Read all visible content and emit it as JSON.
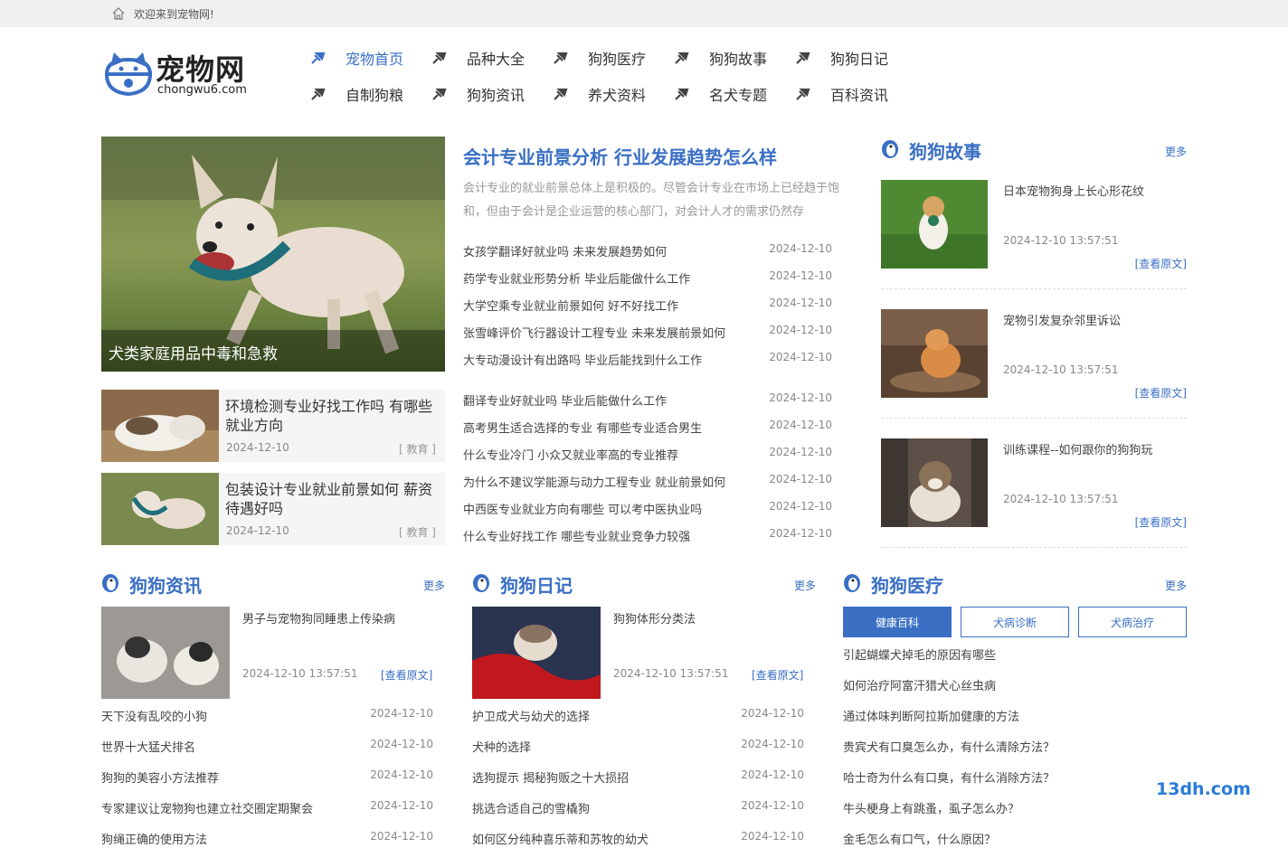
{
  "topbar": {
    "welcome": "欢迎来到宠物网!"
  },
  "logo": {
    "cn": "宠物网",
    "en": "chongwu6.com"
  },
  "nav": [
    {
      "label": "宠物首页",
      "active": true
    },
    {
      "label": "品种大全"
    },
    {
      "label": "狗狗医疗"
    },
    {
      "label": "狗狗故事"
    },
    {
      "label": "狗狗日记"
    },
    {
      "label": "自制狗粮"
    },
    {
      "label": "狗狗资讯"
    },
    {
      "label": "养犬资料"
    },
    {
      "label": "名犬专题"
    },
    {
      "label": "百科资讯"
    }
  ],
  "hero": {
    "caption": "犬类家庭用品中毒和急救"
  },
  "cards": [
    {
      "title": "环境检测专业好找工作吗 有哪些就业方向",
      "date": "2024-12-10",
      "tag": "[ 教育 ]"
    },
    {
      "title": "包装设计专业就业前景如何 薪资待遇好吗",
      "date": "2024-12-10",
      "tag": "[ 教育 ]"
    }
  ],
  "headline": {
    "title": "会计专业前景分析 行业发展趋势怎么样",
    "summary": "会计专业的就业前景总体上是积极的。尽管会计专业在市场上已经趋于饱和，但由于会计是企业运营的核心部门，对会计人才的需求仍然存"
  },
  "news_group1": [
    {
      "title": "女孩学翻译好就业吗 未来发展趋势如何",
      "date": "2024-12-10"
    },
    {
      "title": "药学专业就业形势分析 毕业后能做什么工作",
      "date": "2024-12-10"
    },
    {
      "title": "大学空乘专业就业前景如何 好不好找工作",
      "date": "2024-12-10"
    },
    {
      "title": "张雪峰评价飞行器设计工程专业 未来发展前景如何",
      "date": "2024-12-10"
    },
    {
      "title": "大专动漫设计有出路吗 毕业后能找到什么工作",
      "date": "2024-12-10"
    }
  ],
  "news_group2": [
    {
      "title": "翻译专业好就业吗 毕业后能做什么工作",
      "date": "2024-12-10"
    },
    {
      "title": "高考男生适合选择的专业 有哪些专业适合男生",
      "date": "2024-12-10"
    },
    {
      "title": "什么专业冷门 小众又就业率高的专业推荐",
      "date": "2024-12-10"
    },
    {
      "title": "为什么不建议学能源与动力工程专业 就业前景如何",
      "date": "2024-12-10"
    },
    {
      "title": "中西医专业就业方向有哪些 可以考中医执业吗",
      "date": "2024-12-10"
    },
    {
      "title": "什么专业好找工作 哪些专业就业竞争力较强",
      "date": "2024-12-10"
    }
  ],
  "stories": {
    "title": "狗狗故事",
    "more": "更多",
    "items": [
      {
        "title": "日本宠物狗身上长心形花纹",
        "datetime": "2024-12-10 13:57:51",
        "view": "[查看原文]"
      },
      {
        "title": "宠物引发复杂邻里诉讼",
        "datetime": "2024-12-10 13:57:51",
        "view": "[查看原文]"
      },
      {
        "title": "训练课程--如何跟你的狗狗玩",
        "datetime": "2024-12-10 13:57:51",
        "view": "[查看原文]"
      }
    ]
  },
  "news_sect": {
    "title": "狗狗资讯",
    "more": "更多",
    "featured": {
      "title": "男子与宠物狗同睡患上传染病",
      "datetime": "2024-12-10 13:57:51",
      "view": "[查看原文]"
    },
    "items": [
      {
        "title": "天下没有乱咬的小狗",
        "date": "2024-12-10"
      },
      {
        "title": "世界十大猛犬排名",
        "date": "2024-12-10"
      },
      {
        "title": "狗狗的美容小方法推荐",
        "date": "2024-12-10"
      },
      {
        "title": "专家建议让宠物狗也建立社交圈定期聚会",
        "date": "2024-12-10"
      },
      {
        "title": "狗绳正确的使用方法",
        "date": "2024-12-10"
      }
    ]
  },
  "diary_sect": {
    "title": "狗狗日记",
    "more": "更多",
    "featured": {
      "title": "狗狗体形分类法",
      "datetime": "2024-12-10 13:57:51",
      "view": "[查看原文]"
    },
    "items": [
      {
        "title": "护卫成犬与幼犬的选择",
        "date": "2024-12-10"
      },
      {
        "title": "犬种的选择",
        "date": "2024-12-10"
      },
      {
        "title": "选狗提示 揭秘狗贩之十大损招",
        "date": "2024-12-10"
      },
      {
        "title": "挑选合适自己的雪橇狗",
        "date": "2024-12-10"
      },
      {
        "title": "如何区分纯种喜乐蒂和苏牧的幼犬",
        "date": "2024-12-10"
      }
    ]
  },
  "medical_sect": {
    "title": "狗狗医疗",
    "more": "更多",
    "tabs": [
      "健康百科",
      "犬病诊断",
      "犬病治疗"
    ],
    "items": [
      "引起蝴蝶犬掉毛的原因有哪些",
      "如何治疗阿富汗猎犬心丝虫病",
      "通过体味判断阿拉斯加健康的方法",
      "贵宾犬有口臭怎么办，有什么清除方法？",
      "哈士奇为什么有口臭，有什么消除方法？",
      "牛头梗身上有跳蚤，虱子怎么办？",
      "金毛怎么有口气，什么原因？"
    ]
  },
  "watermark": "13dh.com",
  "colors": {
    "accent": "#3a6fc4",
    "topbar": "#f0f0f0",
    "card_bg": "#f5f5f5"
  }
}
